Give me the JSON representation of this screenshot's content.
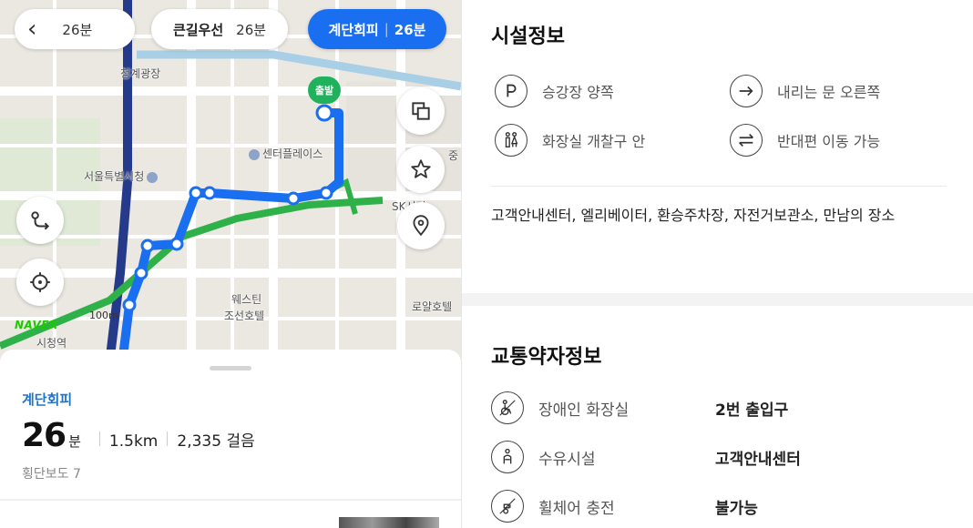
{
  "map": {
    "labels": {
      "cheonggye": "청계광장",
      "center_place": "센터플레이스",
      "seoul_hall_top": "서울특별시청",
      "westin": "웨스틴",
      "westin2": "조선호텔",
      "city_hall_station": "시청역",
      "lotte_hotel": "로얄호텔",
      "jung": "중",
      "skseorin": "SK서린",
      "naver": "NAVER",
      "scale": "100m"
    },
    "start_marker": "출발",
    "colors": {
      "route": "#1a6ef0",
      "line2_green": "#2fb14a",
      "line1_navy": "#263a8c",
      "stream": "#a9cfe6",
      "road": "#ffffff"
    }
  },
  "route_tabs": {
    "back_time": "26분",
    "big_road_label": "큰길우선",
    "big_road_time": "26분",
    "avoid_label": "계단회피",
    "avoid_sep": "|",
    "avoid_time": "26분"
  },
  "map_buttons": {
    "route_icon": "route-icon",
    "locate_icon": "crosshair-icon",
    "layers_icon": "layers-icon",
    "star_icon": "star-icon",
    "pin_icon": "pin-icon"
  },
  "summary": {
    "route_type": "계단회피",
    "time": "26",
    "time_unit": "분",
    "distance": "1.5km",
    "steps": "2,335 걸음",
    "crosswalk": "횡단보도 7"
  },
  "facilities": {
    "title": "시설정보",
    "items": [
      {
        "icon": "parking-icon",
        "label": "승강장 양쪽"
      },
      {
        "icon": "exit-arrow-icon",
        "label": "내리는 문 오른쪽"
      },
      {
        "icon": "restroom-icon",
        "label": "화장실 개찰구 안"
      },
      {
        "icon": "transfer-arrows-icon",
        "label": "반대편 이동 가능"
      }
    ],
    "amenities": "고객안내센터, 엘리베이터, 환승주차장, 자전거보관소, 만남의 장소"
  },
  "accessibility": {
    "title": "교통약자정보",
    "rows": [
      {
        "icon": "accessible-toilet-icon",
        "label": "장애인 화장실",
        "value": "2번 출입구"
      },
      {
        "icon": "nursing-room-icon",
        "label": "수유시설",
        "value": "고객안내센터"
      },
      {
        "icon": "wheelchair-charge-icon",
        "label": "휠체어 충전",
        "value": "불가능"
      }
    ]
  }
}
